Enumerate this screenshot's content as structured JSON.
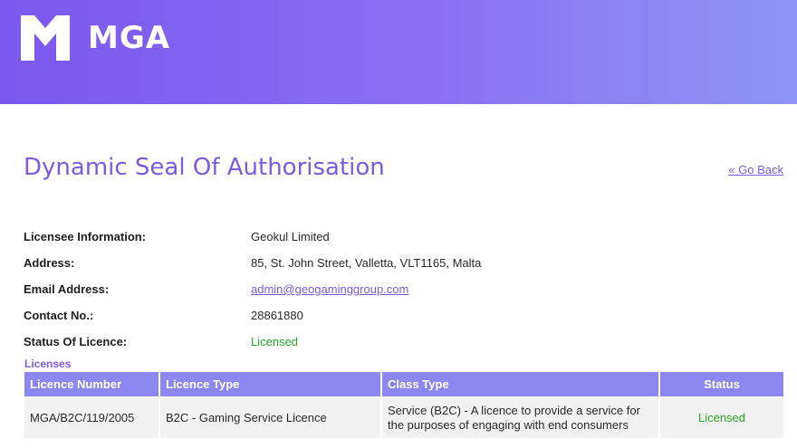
{
  "header": {
    "brand_text": "MGA",
    "logo_icon": "mga-chevron-logo-icon",
    "colors": {
      "gradient_start": "#7b58ef",
      "gradient_end": "#8f95f6"
    }
  },
  "page": {
    "title": "Dynamic Seal Of Authorisation",
    "go_back_label": "« Go Back",
    "accent_color": "#7b5be0"
  },
  "licensee": {
    "rows": [
      {
        "label": "Licensee Information:",
        "value": "Geokul Limited"
      },
      {
        "label": "Address:",
        "value": "85, St. John Street, Valletta, VLT1165, Malta"
      },
      {
        "label": "Email Address:",
        "value": "admin@geogaminggroup.com"
      },
      {
        "label": "Contact No.:",
        "value": "28861880"
      },
      {
        "label": "Status Of Licence:",
        "value": "Licensed"
      }
    ],
    "status_color": "#2aa52a"
  },
  "licenses": {
    "heading": "Licenses",
    "columns": [
      "Licence Number",
      "Licence Type",
      "Class Type",
      "Status"
    ],
    "rows": [
      [
        "MGA/B2C/119/2005",
        "B2C - Gaming Service Licence",
        "Service (B2C) - A licence to provide a service for the purposes of engaging with end consumers",
        "Licensed"
      ]
    ],
    "header_color": "#8d87f2"
  }
}
